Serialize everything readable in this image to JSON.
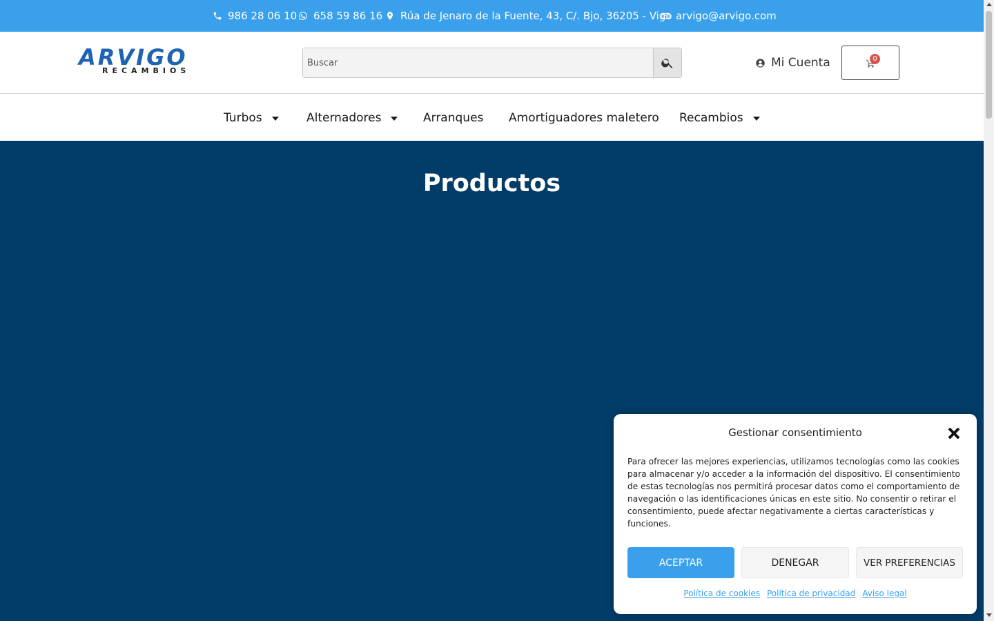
{
  "topbar": {
    "phone": "986 28 06 10",
    "whatsapp": "658 59 86 16",
    "address": "Rúa de Jenaro de la Fuente, 43, C/. Bjo, 36205 - Vigo",
    "email": "arvigo@arvigo.com"
  },
  "header": {
    "logo_main": "ARVIGO",
    "logo_sub": "RECAMBIOS",
    "search_placeholder": "Buscar",
    "account_label": "Mi Cuenta",
    "cart_count": "0"
  },
  "nav": {
    "items": [
      {
        "label": "Turbos",
        "has_dropdown": true
      },
      {
        "label": "Alternadores",
        "has_dropdown": true
      },
      {
        "label": "Arranques",
        "has_dropdown": false
      },
      {
        "label": "Amortiguadores maletero",
        "has_dropdown": false
      },
      {
        "label": "Recambios",
        "has_dropdown": true
      }
    ]
  },
  "hero": {
    "title": "Productos"
  },
  "cookie": {
    "title": "Gestionar consentimiento",
    "text": "Para ofrecer las mejores experiencias, utilizamos tecnologías como las cookies para almacenar y/o acceder a la información del dispositivo. El consentimiento de estas tecnologías nos permitirá procesar datos como el comportamiento de navegación o las identificaciones únicas en este sitio. No consentir o retirar el consentimiento, puede afectar negativamente a ciertas características y funciones.",
    "accept_label": "ACEPTAR",
    "deny_label": "DENEGAR",
    "prefs_label": "VER PREFERENCIAS",
    "links": [
      "Política de cookies",
      "Política de privacidad",
      "Aviso legal"
    ]
  },
  "colors": {
    "topbar_bg": "#3aa0ec",
    "hero_bg": "#023c69",
    "brand_blue": "#1e63b4",
    "accept_bg": "#3aa0ec",
    "link": "#3aa0ec"
  },
  "icons": [
    "phone-icon",
    "whatsapp-icon",
    "map-pin-icon",
    "envelope-icon",
    "search-icon",
    "user-circle-icon",
    "cart-icon",
    "chevron-down-icon",
    "close-icon"
  ]
}
